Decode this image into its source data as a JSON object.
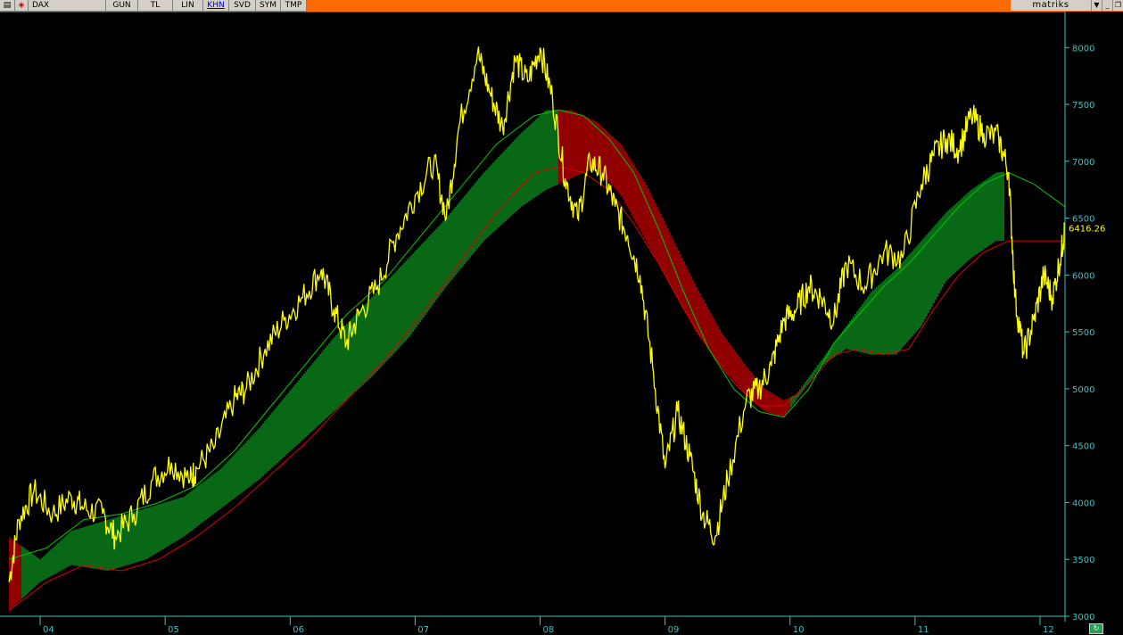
{
  "toolbar": {
    "symbol": "DAX",
    "buttons": [
      "GUN",
      "TL",
      "LIN",
      "KHN",
      "SVD",
      "SYM",
      "TMP"
    ],
    "active": "KHN",
    "brand": "matriks"
  },
  "colors": {
    "price": "#ffff00",
    "band_green": "#0a8a1e",
    "band_red": "#c00000",
    "ma_red": "#e00000",
    "ma_green": "#00c800",
    "axis": "#40c0c0",
    "toolbar": "#ff6a00"
  },
  "chart_data": {
    "type": "line",
    "title": "DAX",
    "last_value_label": "6416.26",
    "ylim": [
      3000,
      8300
    ],
    "y_ticks": [
      3000,
      3500,
      4000,
      4500,
      5000,
      5500,
      6000,
      6500,
      7000,
      7500,
      8000
    ],
    "x_tick_labels": [
      "04",
      "05",
      "06",
      "07",
      "08",
      "09",
      "10",
      "11",
      "12"
    ],
    "x_ticks": [
      2003.75,
      2004.75,
      2005.75,
      2006.75,
      2007.75,
      2008.75,
      2009.75,
      2010.75,
      2011.75
    ],
    "xlim": [
      2003.5,
      2011.95
    ],
    "price_series": {
      "name": "DAX",
      "points": [
        [
          2003.5,
          3300
        ],
        [
          2003.58,
          3850
        ],
        [
          2003.7,
          4100
        ],
        [
          2003.85,
          3900
        ],
        [
          2004.0,
          4050
        ],
        [
          2004.1,
          3950
        ],
        [
          2004.25,
          3900
        ],
        [
          2004.35,
          3700
        ],
        [
          2004.5,
          3900
        ],
        [
          2004.65,
          4200
        ],
        [
          2004.8,
          4350
        ],
        [
          2004.95,
          4200
        ],
        [
          2005.0,
          4300
        ],
        [
          2005.15,
          4500
        ],
        [
          2005.3,
          4900
        ],
        [
          2005.4,
          5000
        ],
        [
          2005.55,
          5350
        ],
        [
          2005.7,
          5600
        ],
        [
          2005.85,
          5800
        ],
        [
          2006.0,
          6050
        ],
        [
          2006.1,
          5700
        ],
        [
          2006.2,
          5400
        ],
        [
          2006.3,
          5650
        ],
        [
          2006.45,
          5900
        ],
        [
          2006.6,
          6350
        ],
        [
          2006.75,
          6700
        ],
        [
          2006.9,
          7000
        ],
        [
          2007.0,
          6500
        ],
        [
          2007.1,
          7300
        ],
        [
          2007.25,
          7950
        ],
        [
          2007.35,
          7600
        ],
        [
          2007.45,
          7300
        ],
        [
          2007.55,
          7900
        ],
        [
          2007.65,
          7700
        ],
        [
          2007.75,
          8000
        ],
        [
          2007.85,
          7550
        ],
        [
          2007.95,
          6850
        ],
        [
          2008.05,
          6500
        ],
        [
          2008.15,
          7000
        ],
        [
          2008.25,
          6900
        ],
        [
          2008.35,
          6600
        ],
        [
          2008.45,
          6350
        ],
        [
          2008.55,
          6000
        ],
        [
          2008.65,
          5200
        ],
        [
          2008.75,
          4300
        ],
        [
          2008.85,
          4800
        ],
        [
          2008.95,
          4400
        ],
        [
          2009.05,
          3900
        ],
        [
          2009.15,
          3700
        ],
        [
          2009.25,
          4200
        ],
        [
          2009.4,
          4900
        ],
        [
          2009.5,
          5000
        ],
        [
          2009.6,
          5200
        ],
        [
          2009.7,
          5600
        ],
        [
          2009.8,
          5700
        ],
        [
          2009.9,
          5900
        ],
        [
          2010.0,
          5800
        ],
        [
          2010.1,
          5600
        ],
        [
          2010.2,
          6100
        ],
        [
          2010.35,
          5900
        ],
        [
          2010.5,
          6200
        ],
        [
          2010.65,
          6150
        ],
        [
          2010.8,
          6800
        ],
        [
          2010.9,
          7050
        ],
        [
          2011.0,
          7200
        ],
        [
          2011.1,
          7100
        ],
        [
          2011.2,
          7400
        ],
        [
          2011.3,
          7250
        ],
        [
          2011.42,
          7200
        ],
        [
          2011.5,
          6900
        ],
        [
          2011.55,
          5800
        ],
        [
          2011.62,
          5300
        ],
        [
          2011.7,
          5600
        ],
        [
          2011.78,
          6000
        ],
        [
          2011.85,
          5800
        ],
        [
          2011.92,
          6200
        ],
        [
          2011.95,
          6416.26
        ]
      ]
    },
    "upper_band": {
      "name": "upper",
      "points": [
        [
          2003.5,
          3700
        ],
        [
          2003.75,
          3500
        ],
        [
          2004.0,
          3750
        ],
        [
          2004.3,
          3850
        ],
        [
          2004.6,
          3950
        ],
        [
          2004.9,
          4050
        ],
        [
          2005.2,
          4300
        ],
        [
          2005.5,
          4650
        ],
        [
          2005.8,
          5050
        ],
        [
          2006.1,
          5450
        ],
        [
          2006.4,
          5800
        ],
        [
          2006.7,
          6150
        ],
        [
          2007.0,
          6500
        ],
        [
          2007.3,
          6900
        ],
        [
          2007.6,
          7250
        ],
        [
          2007.8,
          7450
        ],
        [
          2008.0,
          7450
        ],
        [
          2008.2,
          7350
        ],
        [
          2008.4,
          7150
        ],
        [
          2008.6,
          6800
        ],
        [
          2008.8,
          6350
        ],
        [
          2009.0,
          5900
        ],
        [
          2009.2,
          5500
        ],
        [
          2009.4,
          5200
        ],
        [
          2009.55,
          5000
        ],
        [
          2009.7,
          4900
        ],
        [
          2009.8,
          4950
        ],
        [
          2010.0,
          5250
        ],
        [
          2010.2,
          5550
        ],
        [
          2010.4,
          5850
        ],
        [
          2010.6,
          6050
        ],
        [
          2010.8,
          6300
        ],
        [
          2011.0,
          6550
        ],
        [
          2011.2,
          6750
        ],
        [
          2011.4,
          6900
        ],
        [
          2011.55,
          6920
        ],
        [
          2011.7,
          6850
        ],
        [
          2011.85,
          6700
        ],
        [
          2011.95,
          6600
        ]
      ]
    },
    "lower_band": {
      "name": "lower",
      "points": [
        [
          2003.5,
          3050
        ],
        [
          2003.75,
          3300
        ],
        [
          2004.0,
          3450
        ],
        [
          2004.3,
          3400
        ],
        [
          2004.6,
          3500
        ],
        [
          2004.9,
          3700
        ],
        [
          2005.2,
          3950
        ],
        [
          2005.5,
          4200
        ],
        [
          2005.8,
          4500
        ],
        [
          2006.1,
          4800
        ],
        [
          2006.4,
          5100
        ],
        [
          2006.7,
          5450
        ],
        [
          2007.0,
          5900
        ],
        [
          2007.3,
          6300
        ],
        [
          2007.6,
          6600
        ],
        [
          2007.8,
          6750
        ],
        [
          2008.0,
          6850
        ],
        [
          2008.2,
          6950
        ],
        [
          2008.4,
          6700
        ],
        [
          2008.6,
          6300
        ],
        [
          2008.8,
          5900
        ],
        [
          2009.0,
          5500
        ],
        [
          2009.2,
          5200
        ],
        [
          2009.4,
          4950
        ],
        [
          2009.55,
          4800
        ],
        [
          2009.7,
          4750
        ],
        [
          2009.8,
          4900
        ],
        [
          2010.0,
          5200
        ],
        [
          2010.2,
          5350
        ],
        [
          2010.4,
          5300
        ],
        [
          2010.6,
          5300
        ],
        [
          2010.8,
          5550
        ],
        [
          2011.0,
          5950
        ],
        [
          2011.2,
          6150
        ],
        [
          2011.4,
          6300
        ],
        [
          2011.55,
          6300
        ],
        [
          2011.7,
          6300
        ],
        [
          2011.85,
          6300
        ],
        [
          2011.95,
          6300
        ]
      ]
    },
    "ma_red": {
      "name": "ma-red",
      "points": [
        [
          2003.5,
          3050
        ],
        [
          2003.8,
          3300
        ],
        [
          2004.1,
          3450
        ],
        [
          2004.4,
          3400
        ],
        [
          2004.7,
          3500
        ],
        [
          2005.0,
          3700
        ],
        [
          2005.3,
          3950
        ],
        [
          2005.6,
          4250
        ],
        [
          2005.9,
          4550
        ],
        [
          2006.2,
          4900
        ],
        [
          2006.5,
          5250
        ],
        [
          2006.8,
          5650
        ],
        [
          2007.1,
          6100
        ],
        [
          2007.4,
          6550
        ],
        [
          2007.7,
          6900
        ],
        [
          2007.9,
          6950
        ],
        [
          2008.1,
          6900
        ],
        [
          2008.3,
          6750
        ],
        [
          2008.5,
          6450
        ],
        [
          2008.7,
          6100
        ],
        [
          2008.9,
          5700
        ],
        [
          2009.1,
          5350
        ],
        [
          2009.3,
          5050
        ],
        [
          2009.5,
          4850
        ],
        [
          2009.7,
          4850
        ],
        [
          2009.9,
          5050
        ],
        [
          2010.1,
          5300
        ],
        [
          2010.3,
          5350
        ],
        [
          2010.5,
          5300
        ],
        [
          2010.7,
          5350
        ],
        [
          2010.9,
          5700
        ],
        [
          2011.1,
          6000
        ],
        [
          2011.3,
          6200
        ],
        [
          2011.5,
          6300
        ],
        [
          2011.7,
          6300
        ],
        [
          2011.95,
          6300
        ]
      ]
    },
    "ma_green": {
      "name": "ma-green",
      "points": [
        [
          2003.5,
          3500
        ],
        [
          2003.8,
          3600
        ],
        [
          2004.1,
          3850
        ],
        [
          2004.4,
          3900
        ],
        [
          2004.7,
          4000
        ],
        [
          2005.0,
          4150
        ],
        [
          2005.3,
          4450
        ],
        [
          2005.6,
          4850
        ],
        [
          2005.9,
          5250
        ],
        [
          2006.2,
          5650
        ],
        [
          2006.5,
          5950
        ],
        [
          2006.8,
          6350
        ],
        [
          2007.1,
          6750
        ],
        [
          2007.4,
          7150
        ],
        [
          2007.7,
          7400
        ],
        [
          2007.9,
          7450
        ],
        [
          2008.1,
          7400
        ],
        [
          2008.3,
          7200
        ],
        [
          2008.5,
          6900
        ],
        [
          2008.7,
          6400
        ],
        [
          2008.9,
          5850
        ],
        [
          2009.1,
          5350
        ],
        [
          2009.3,
          5000
        ],
        [
          2009.5,
          4800
        ],
        [
          2009.7,
          4750
        ],
        [
          2009.9,
          5000
        ],
        [
          2010.1,
          5400
        ],
        [
          2010.3,
          5650
        ],
        [
          2010.5,
          5900
        ],
        [
          2010.7,
          6100
        ],
        [
          2010.9,
          6350
        ],
        [
          2011.1,
          6600
        ],
        [
          2011.3,
          6800
        ],
        [
          2011.5,
          6900
        ],
        [
          2011.7,
          6800
        ],
        [
          2011.95,
          6600
        ]
      ]
    }
  }
}
